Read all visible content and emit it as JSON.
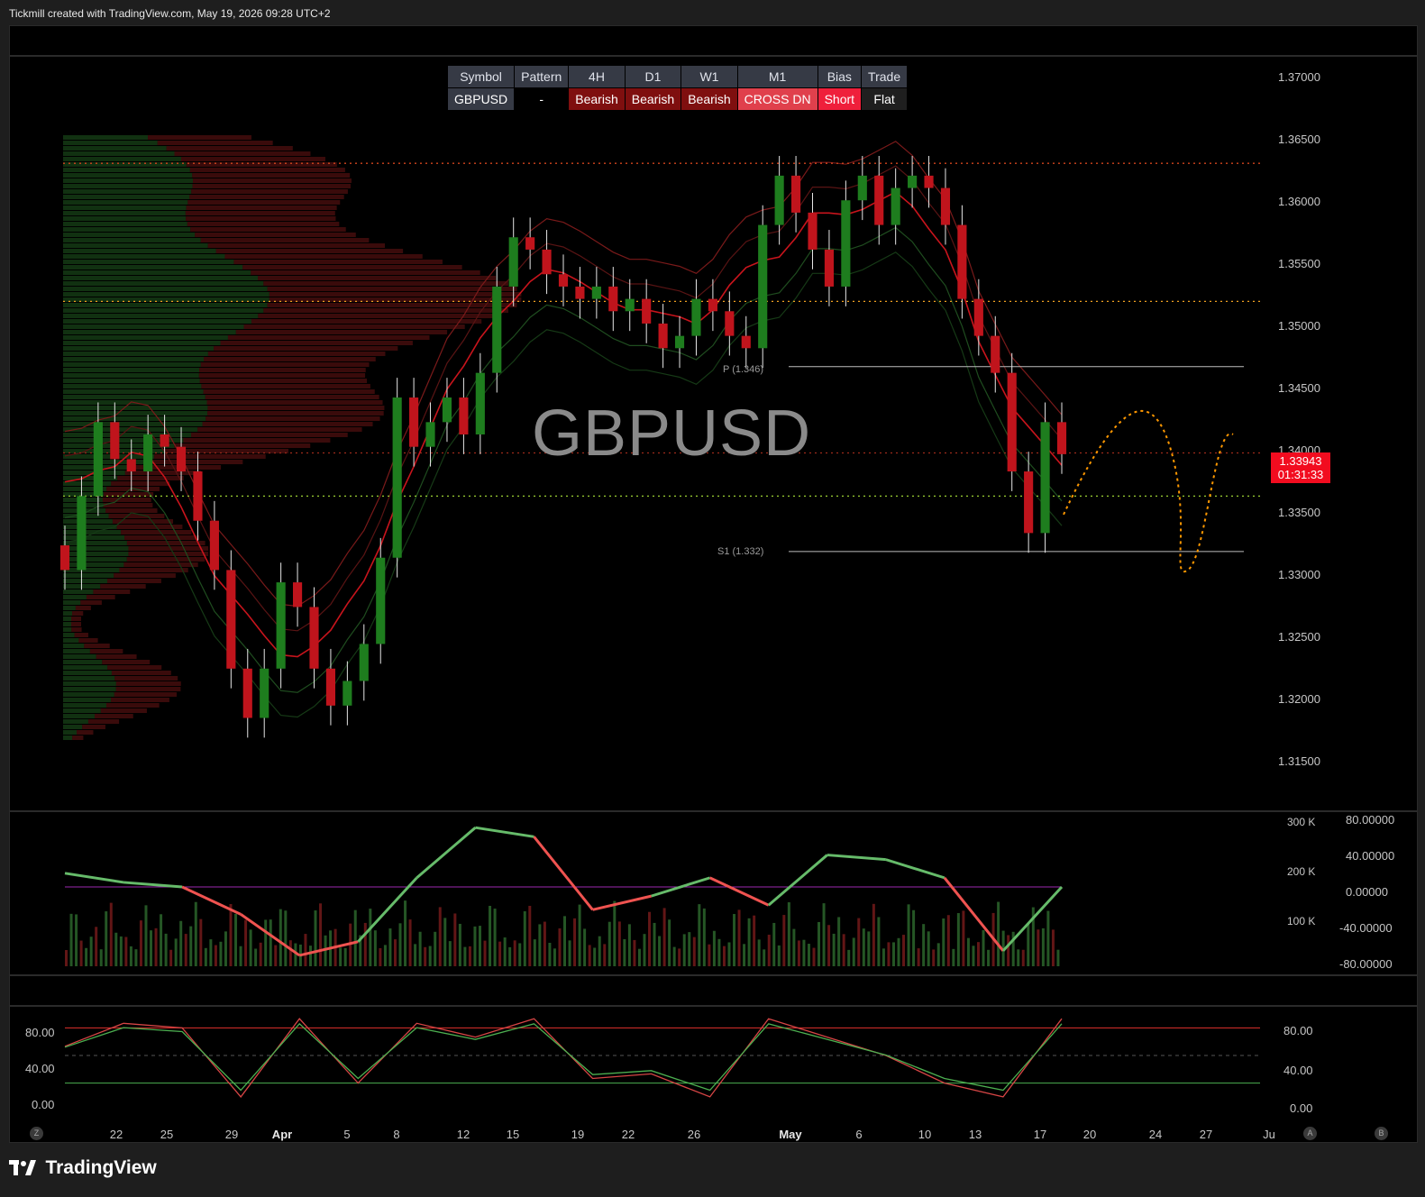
{
  "header": {
    "caption": "Tickmill created with TradingView.com, May 19, 2026 09:28 UTC+2"
  },
  "watermark": "GBPUSD",
  "status_table": {
    "headers": [
      "Symbol",
      "Pattern",
      "4H",
      "D1",
      "W1",
      "M1",
      "Bias",
      "Trade"
    ],
    "values": [
      "GBPUSD",
      "-",
      "Bearish",
      "Bearish",
      "Bearish",
      "CROSS DN",
      "Short",
      "Flat"
    ]
  },
  "price_axis": {
    "labels": [
      "1.37000",
      "1.36500",
      "1.36000",
      "1.35500",
      "1.35000",
      "1.34500",
      "1.34000",
      "1.33500",
      "1.33000",
      "1.32500",
      "1.32000",
      "1.31500"
    ]
  },
  "last_price": {
    "price": "1.33943",
    "countdown": "01:31:33"
  },
  "pivots": {
    "p": "P (1.346)",
    "s1": "S1 (1.332)"
  },
  "oscillator": {
    "volume_labels": [
      "300 K",
      "200 K",
      "100 K"
    ],
    "value_labels": [
      "80.00000",
      "40.00000",
      "0.00000",
      "-40.00000",
      "-80.00000"
    ]
  },
  "stochastic": {
    "left_labels": [
      "80.00",
      "40.00",
      "0.00"
    ],
    "right_labels": [
      "80.00",
      "40.00",
      "0.00"
    ]
  },
  "time_axis": {
    "labels": [
      "22",
      "25",
      "29",
      "Apr",
      "5",
      "8",
      "12",
      "15",
      "19",
      "22",
      "26",
      "May",
      "6",
      "10",
      "13",
      "17",
      "20",
      "24",
      "27",
      "Ju"
    ],
    "circle_left": "Z",
    "circle_a": "A",
    "circle_b": "B"
  },
  "footer": {
    "brand": "TradingView"
  },
  "colors": {
    "bull": "#1e7d1e",
    "bear": "#c0141c",
    "accent_red": "#f20c1f",
    "forecast": "#ff9800",
    "osc_green": "#66bb6a",
    "osc_red": "#ef5350"
  },
  "chart_data": [
    {
      "type": "candlestick",
      "title": "GBPUSD",
      "ylim": [
        1.3115,
        1.372
      ],
      "x": [
        "Mar 19",
        "Mar 20",
        "Mar 21",
        "Mar 22",
        "Mar 23",
        "Mar 24",
        "Mar 25",
        "Mar 26",
        "Mar 27",
        "Mar 28",
        "Mar 29",
        "Mar 30",
        "Mar 31",
        "Apr 1",
        "Apr 2",
        "Apr 3",
        "Apr 4",
        "Apr 5",
        "Apr 6",
        "Apr 7",
        "Apr 8",
        "Apr 9",
        "Apr 10",
        "Apr 11",
        "Apr 12",
        "Apr 13",
        "Apr 14",
        "Apr 15",
        "Apr 16",
        "Apr 17",
        "Apr 18",
        "Apr 19",
        "Apr 20",
        "Apr 21",
        "Apr 22",
        "Apr 23",
        "Apr 24",
        "Apr 25",
        "Apr 26",
        "Apr 27",
        "Apr 28",
        "Apr 29",
        "Apr 30",
        "May 1",
        "May 2",
        "May 3",
        "May 4",
        "May 5",
        "May 6",
        "May 7",
        "May 8",
        "May 9",
        "May 10",
        "May 11",
        "May 12",
        "May 13",
        "May 14",
        "May 15",
        "May 16",
        "May 17",
        "May 18"
      ],
      "close": [
        1.33,
        1.336,
        1.342,
        1.339,
        1.338,
        1.341,
        1.34,
        1.338,
        1.334,
        1.33,
        1.322,
        1.318,
        1.322,
        1.329,
        1.327,
        1.322,
        1.319,
        1.321,
        1.324,
        1.331,
        1.344,
        1.34,
        1.342,
        1.344,
        1.341,
        1.346,
        1.353,
        1.357,
        1.356,
        1.354,
        1.353,
        1.352,
        1.353,
        1.351,
        1.352,
        1.35,
        1.348,
        1.349,
        1.352,
        1.351,
        1.349,
        1.348,
        1.358,
        1.362,
        1.359,
        1.356,
        1.353,
        1.36,
        1.362,
        1.358,
        1.361,
        1.362,
        1.361,
        1.358,
        1.352,
        1.349,
        1.346,
        1.338,
        1.333,
        1.342,
        1.3394
      ],
      "pivot_p": 1.3465,
      "pivot_s1": 1.3315,
      "horizontal_levels": [
        1.363,
        1.3518,
        1.3395,
        1.336
      ]
    },
    {
      "type": "line",
      "title": "Oscillator",
      "ylim": [
        -80,
        80
      ],
      "x": [
        "Mar 19",
        "Mar 22",
        "Mar 25",
        "Mar 29",
        "Apr 1",
        "Apr 5",
        "Apr 8",
        "Apr 12",
        "Apr 15",
        "Apr 19",
        "Apr 22",
        "Apr 26",
        "May 1",
        "May 6",
        "May 10",
        "May 13",
        "May 17",
        "May 18"
      ],
      "series": [
        {
          "values": [
            15,
            5,
            0,
            -30,
            -75,
            -60,
            10,
            65,
            55,
            -25,
            -10,
            10,
            -20,
            35,
            30,
            10,
            -70,
            0
          ]
        }
      ]
    },
    {
      "type": "line",
      "title": "Stochastic",
      "ylim": [
        0,
        100
      ],
      "x": [
        "Mar 19",
        "Mar 22",
        "Mar 25",
        "Mar 29",
        "Apr 1",
        "Apr 5",
        "Apr 8",
        "Apr 12",
        "Apr 15",
        "Apr 19",
        "Apr 22",
        "Apr 26",
        "May 1",
        "May 6",
        "May 10",
        "May 13",
        "May 17",
        "May 18"
      ],
      "series": [
        {
          "values": [
            60,
            85,
            80,
            5,
            90,
            20,
            85,
            70,
            90,
            25,
            30,
            5,
            90,
            70,
            50,
            20,
            5,
            90
          ]
        }
      ]
    }
  ]
}
